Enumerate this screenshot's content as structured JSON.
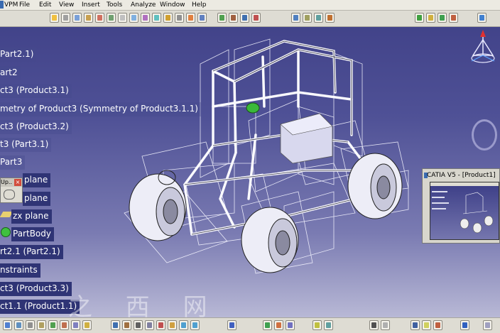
{
  "menubar": {
    "items": [
      "VPM",
      "File",
      "Edit",
      "View",
      "Insert",
      "Tools",
      "Analyze",
      "Window",
      "Help"
    ]
  },
  "tree": [
    {
      "label": "Part2.1)",
      "highlight": false
    },
    {
      "label": "art2",
      "highlight": false
    },
    {
      "label": "ct3 (Product3.1)",
      "highlight": false
    },
    {
      "label": "metry of Product3 (Symmetry of Product3.1.1)",
      "highlight": false
    },
    {
      "label": "ct3 (Product3.2)",
      "highlight": false
    },
    {
      "label": "t3 (Part3.1)",
      "highlight": false
    },
    {
      "label": "Part3",
      "highlight": false
    },
    {
      "label": "plane",
      "highlight": true
    },
    {
      "label": "plane",
      "highlight": true
    },
    {
      "label": "zx plane",
      "highlight": true
    },
    {
      "label": "PartBody",
      "highlight": true
    },
    {
      "label": "rt2.1 (Part2.1)",
      "highlight": true
    },
    {
      "label": "nstraints",
      "highlight": true
    },
    {
      "label": "ct3 (Product3.3)",
      "highlight": true
    },
    {
      "label": "ct1.1 (Product1.1)",
      "highlight": true
    }
  ],
  "mini_window": {
    "title": "Up..",
    "close": "×"
  },
  "thumbnail": {
    "title": "CATIA V5 - [Product1]"
  },
  "watermark": "之 西 网",
  "colors": {
    "background_top": "#3e3f86",
    "background_bottom": "#c4c4dc",
    "toolbar": "#dedcd3",
    "tree_highlight": "#2f3475"
  }
}
